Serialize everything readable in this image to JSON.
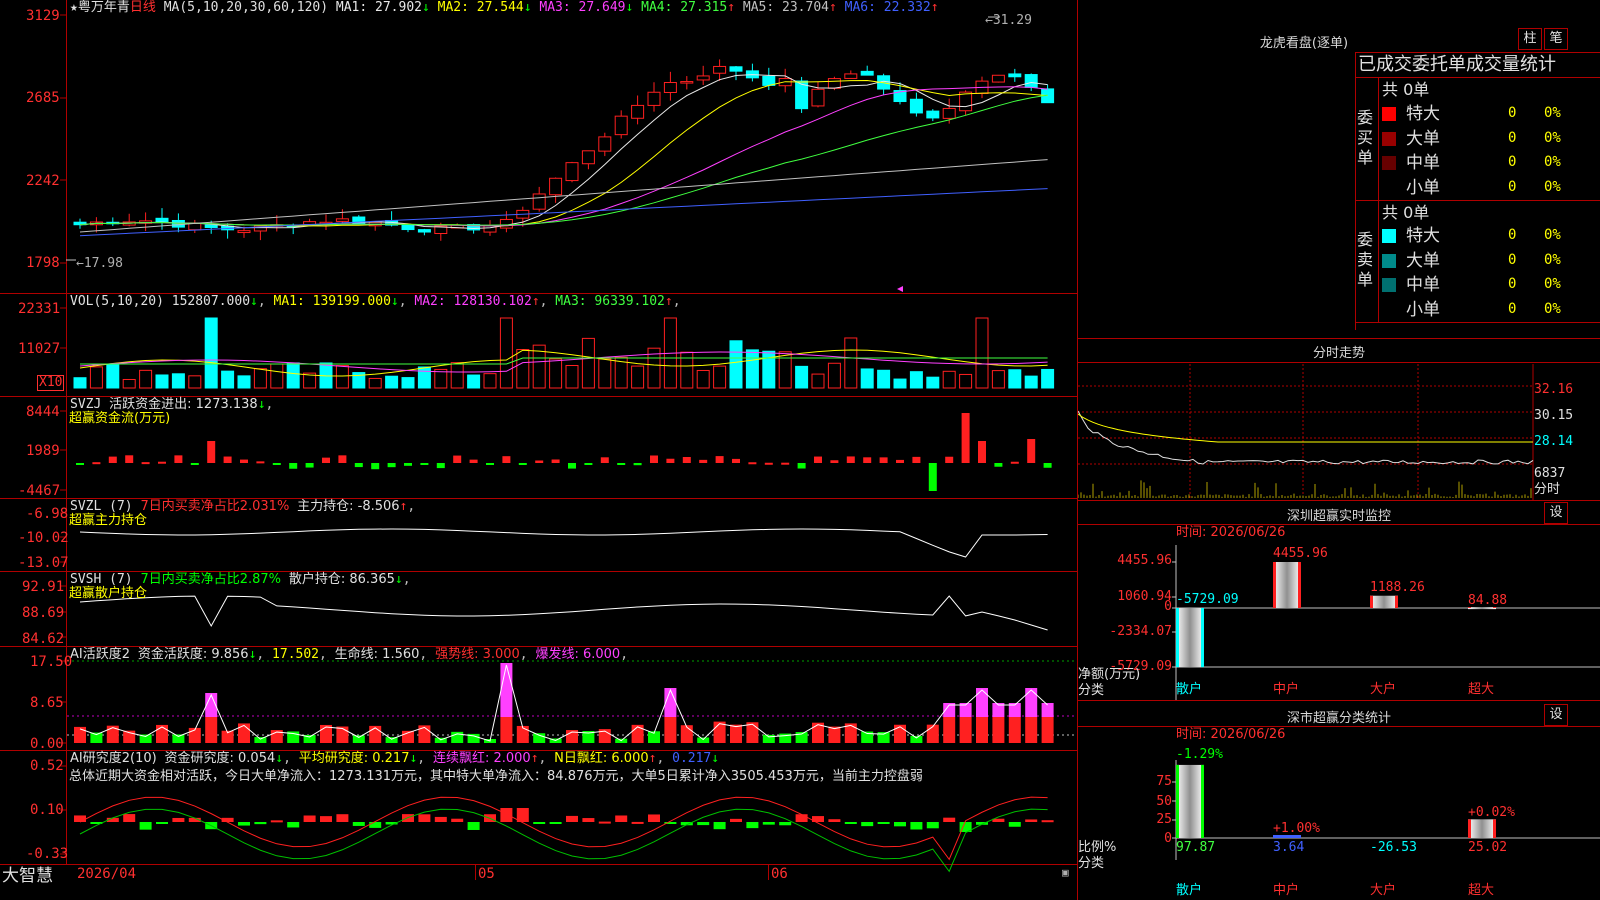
{
  "main_panel": {
    "title_star": "★",
    "stock_name": "粤万年青",
    "period": "日线",
    "ma_params": "MA(5,10,20,30,60,120)",
    "ma_items": [
      {
        "label": "MA1: 27.902",
        "arrow": "↓",
        "color": "#e8e8e8"
      },
      {
        "label": "MA2: 27.544",
        "arrow": "↓",
        "color": "#ffff00"
      },
      {
        "label": "MA3: 27.649",
        "arrow": "↓",
        "color": "#ff40ff"
      },
      {
        "label": "MA4: 27.315",
        "arrow": "↑",
        "color": "#40ff40"
      },
      {
        "label": "MA5: 23.704",
        "arrow": "↑",
        "color": "#c0c0c0"
      },
      {
        "label": "MA6: 22.332",
        "arrow": "↑",
        "color": "#4060ff"
      }
    ],
    "y_ticks": [
      "3129",
      "2685",
      "2242",
      "1798"
    ],
    "high_marker": "31.29",
    "low_marker": "17.98"
  },
  "vol_panel": {
    "title": "VOL(5,10,20)",
    "value": "152807.000",
    "value_arrow": "↓",
    "ma_items": [
      {
        "label": "MA1: 139199.000",
        "arrow": "↓",
        "color": "#ffff00"
      },
      {
        "label": "MA2: 128130.102",
        "arrow": "↑",
        "color": "#ff40ff"
      },
      {
        "label": "MA3: 96339.102",
        "arrow": "↑",
        "color": "#40ff40"
      }
    ],
    "y_ticks": [
      "22331",
      "11027"
    ],
    "unit": "X10"
  },
  "svzj_panel": {
    "title": "SVZJ",
    "label": "活跃资金进出: 1273.138",
    "arrow": "↓",
    "subtitle": "超赢资金流(万元)",
    "y_ticks": [
      "8444",
      "1989",
      "-4467"
    ]
  },
  "svzl_panel": {
    "title": "SVZL (7)",
    "label_red": "7日内买卖净占比2.031%",
    "label2": "主力持仓: -8.506",
    "arrow": "↑",
    "subtitle": "超赢主力持仓",
    "y_ticks": [
      "-6.98",
      "-10.02",
      "-13.07"
    ]
  },
  "svsh_panel": {
    "title": "SVSH (7)",
    "label_green": "7日内买卖净占比2.87%",
    "label2": "散户持仓: 86.365",
    "arrow": "↓",
    "subtitle": "超赢散户持仓",
    "y_ticks": [
      "92.91",
      "88.69",
      "84.62"
    ]
  },
  "ai_active_panel": {
    "title": "AI活跃度2",
    "label1": "资金活跃度: 9.856",
    "arrow1": "↓",
    "label2": "17.502",
    "label3": "生命线: 1.560",
    "label4": "强势线: 3.000",
    "label5": "爆发线: 6.000",
    "y_ticks": [
      "17.50",
      "8.65",
      "0.00"
    ]
  },
  "ai_research_panel": {
    "title": "AI研究度2(10)",
    "label1": "资金研究度: 0.054",
    "arrow1": "↓",
    "label2": "平均研究度: 0.217",
    "arrow2": "↓",
    "label3": "连续飘红: 2.000",
    "arrow3": "↑",
    "label4": "N日飘红: 6.000",
    "arrow4": "↑",
    "label5": "0.217",
    "arrow5": "↓",
    "summary": "总体近期大资金相对活跃，今日大单净流入：1273.131万元，其中特大单净流入：84.876万元，大单5日累计净入3505.453万元，当前主力控盘弱",
    "y_ticks": [
      "0.52",
      "0.10",
      "-0.33"
    ]
  },
  "footer": {
    "brand": "大智慧",
    "date_label": "2026/04",
    "month_05": "05",
    "month_06": "06"
  },
  "dragon_panel": {
    "title": "龙虎看盘(逐单)",
    "btn_bar": "柱",
    "btn_pen": "笔",
    "header": "已成交委托单成交量统计",
    "buy_side_label": "委买单",
    "sell_side_label": "委卖单",
    "buy_total": "共 0单",
    "sell_total": "共 0单",
    "buy_rows": [
      {
        "name": "特大",
        "count": "0",
        "pct": "0%",
        "color": "#ff0000"
      },
      {
        "name": "大单",
        "count": "0",
        "pct": "0%",
        "color": "#990000"
      },
      {
        "name": "中单",
        "count": "0",
        "pct": "0%",
        "color": "#660000"
      },
      {
        "name": "小单",
        "count": "0",
        "pct": "0%",
        "color": "#000000"
      }
    ],
    "sell_rows": [
      {
        "name": "特大",
        "count": "0",
        "pct": "0%",
        "color": "#00ffff"
      },
      {
        "name": "大单",
        "count": "0",
        "pct": "0%",
        "color": "#008b8b"
      },
      {
        "name": "中单",
        "count": "0",
        "pct": "0%",
        "color": "#007070"
      },
      {
        "name": "小单",
        "count": "0",
        "pct": "0%",
        "color": "#000000"
      }
    ]
  },
  "intraday_panel": {
    "title": "分时走势",
    "y_ticks": [
      "32.16",
      "30.15",
      "28.14"
    ],
    "vol_tick": "6837",
    "vol_label": "分时"
  },
  "sz_monitor_panel": {
    "title": "深圳超赢实时监控",
    "settings": "设",
    "time_label": "时间: 2026/06/26",
    "y_label": "净额(万元)",
    "x_label": "分类",
    "y_ticks": [
      "4455.96",
      "1060.94",
      "0",
      "-2334.07",
      "-5729.09"
    ],
    "categories": [
      "散户",
      "中户",
      "大户",
      "超大"
    ],
    "bar_labels": [
      "-5729.09",
      "4455.96",
      "1188.26",
      "84.88"
    ]
  },
  "sz_class_panel": {
    "title": "深市超赢分类统计",
    "settings": "设",
    "time_label": "时间: 2026/06/26",
    "y_label": "比例%",
    "x_label": "分类",
    "y_ticks": [
      "75",
      "50",
      "25",
      "0"
    ],
    "categories": [
      "散户",
      "中户",
      "大户",
      "超大"
    ],
    "top_labels": [
      "-1.29%",
      "+1.00%",
      "",
      "+0.02%"
    ],
    "bottom_labels": [
      "97.87",
      "3.64",
      "-26.53",
      "25.02"
    ]
  }
}
